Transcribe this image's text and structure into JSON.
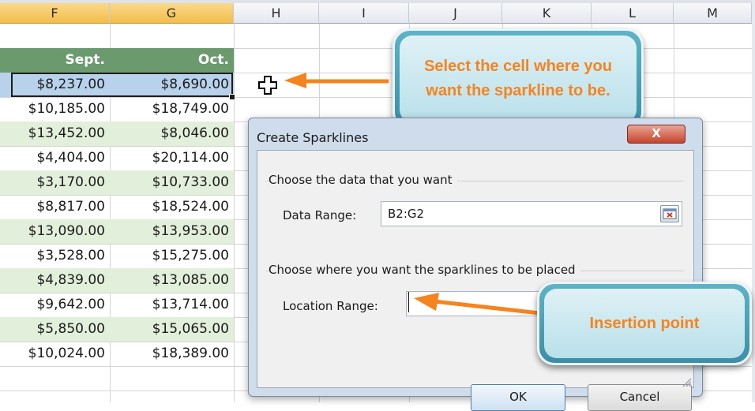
{
  "columns": [
    "F",
    "G",
    "H",
    "I",
    "J",
    "K",
    "L",
    "M"
  ],
  "header_row": {
    "f": "Sept.",
    "g": "Oct."
  },
  "rows": [
    {
      "f": "$8,237.00",
      "g": "$8,690.00"
    },
    {
      "f": "$10,185.00",
      "g": "$18,749.00"
    },
    {
      "f": "$13,452.00",
      "g": "$8,046.00"
    },
    {
      "f": "$4,404.00",
      "g": "$20,114.00"
    },
    {
      "f": "$3,170.00",
      "g": "$10,733.00"
    },
    {
      "f": "$8,817.00",
      "g": "$18,524.00"
    },
    {
      "f": "$13,090.00",
      "g": "$13,953.00"
    },
    {
      "f": "$3,528.00",
      "g": "$15,275.00"
    },
    {
      "f": "$4,839.00",
      "g": "$13,085.00"
    },
    {
      "f": "$9,642.00",
      "g": "$13,714.00"
    },
    {
      "f": "$5,850.00",
      "g": "$15,065.00"
    },
    {
      "f": "$10,024.00",
      "g": "$18,389.00"
    }
  ],
  "dialog": {
    "title": "Create Sparklines",
    "close_label": "X",
    "data_group": "Choose the data that you want",
    "data_range_label": "Data Range:",
    "data_range_value": "B2:G2",
    "location_group": "Choose where you want the sparklines to be placed",
    "location_range_label": "Location Range:",
    "location_range_value": "",
    "ok_label": "OK",
    "cancel_label": "Cancel"
  },
  "callouts": {
    "top": "Select the cell where you want the sparkline to be.",
    "bottom": "Insertion point"
  },
  "icons": [
    "plus-cursor-icon",
    "range-picker-icon",
    "close-icon",
    "resize-grip-icon"
  ],
  "colors": {
    "accent": "#f5841f",
    "header_green": "#6a9a6e",
    "selection": "#b8d2ec"
  }
}
